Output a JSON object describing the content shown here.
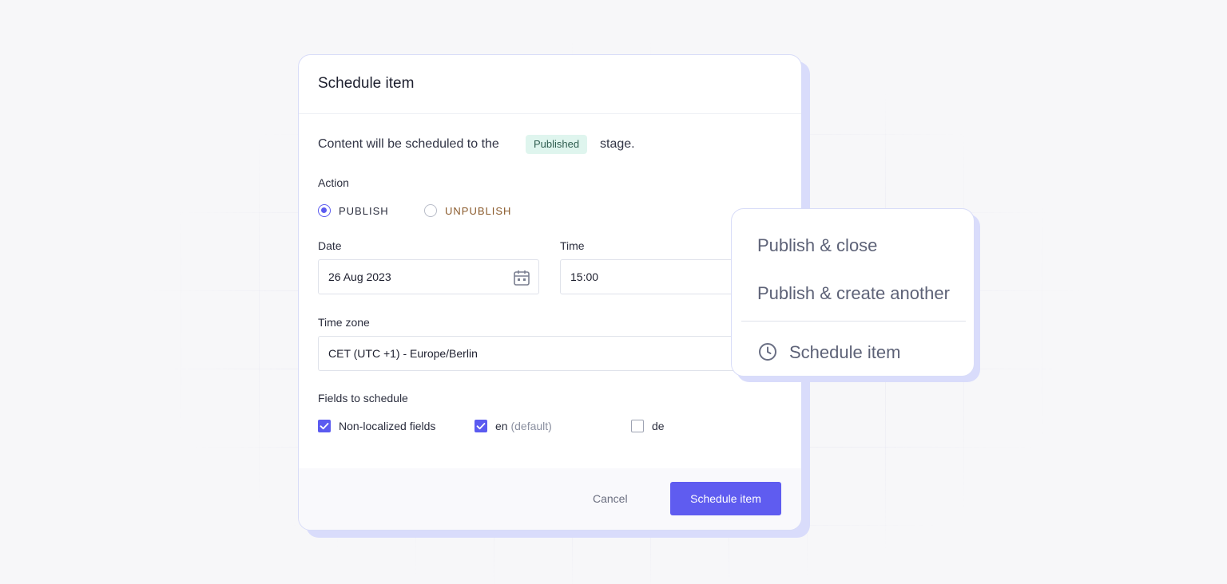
{
  "dialog": {
    "title": "Schedule item",
    "intro_prefix": "Content will be scheduled to the",
    "stage_badge": "Published",
    "intro_suffix": "stage.",
    "action": {
      "label": "Action",
      "options": [
        {
          "label": "PUBLISH",
          "selected": true,
          "color": "#2b2e3e"
        },
        {
          "label": "UNPUBLISH",
          "selected": false,
          "color": "#8a5a2b"
        }
      ]
    },
    "date": {
      "label": "Date",
      "value": "26 Aug 2023",
      "icon": "calendar-icon"
    },
    "time": {
      "label": "Time",
      "value": "15:00"
    },
    "timezone": {
      "label": "Time zone",
      "value": "CET (UTC +1) - Europe/Berlin"
    },
    "fields": {
      "label": "Fields to schedule",
      "options": [
        {
          "label": "Non-localized fields",
          "suffix": "",
          "checked": true
        },
        {
          "label": "en",
          "suffix": "(default)",
          "checked": true
        },
        {
          "label": "de",
          "suffix": "",
          "checked": false
        }
      ]
    },
    "footer": {
      "cancel_label": "Cancel",
      "schedule_label": "Schedule item"
    }
  },
  "menu": {
    "items": [
      "Publish & close",
      "Publish & create another"
    ],
    "schedule_label": "Schedule item",
    "schedule_icon": "clock-icon"
  },
  "colors": {
    "accent": "#5f5cf0",
    "badge_bg": "#dff5ee",
    "outline": "#d8dcf8"
  }
}
